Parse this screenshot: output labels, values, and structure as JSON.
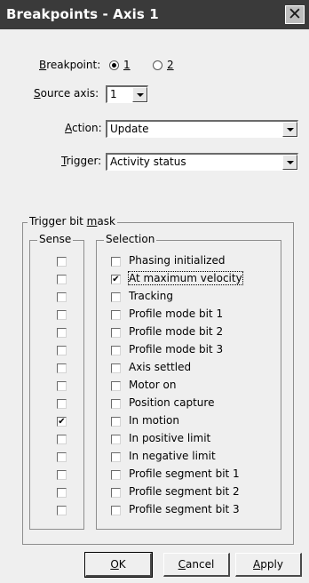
{
  "window": {
    "title": "Breakpoints - Axis 1",
    "close_glyph": "✕"
  },
  "breakpoint": {
    "label_u": "B",
    "label_rest": "reakpoint:",
    "options": [
      {
        "label": "1",
        "selected": true
      },
      {
        "label": "2",
        "selected": false
      }
    ]
  },
  "source_axis": {
    "label_u": "S",
    "label_rest": "ource axis:",
    "value": "1"
  },
  "action": {
    "label_u": "A",
    "label_rest": "ction:",
    "value": "Update"
  },
  "trigger": {
    "label_u": "T",
    "label_rest": "rigger:",
    "value": "Activity status"
  },
  "mask": {
    "legend_pre": "Trigger bit ",
    "legend_u": "m",
    "legend_post": "ask",
    "sense_label": "Sense",
    "selection_label": "Selection",
    "rows": [
      {
        "label": "Phasing initialized",
        "sense": false,
        "selected": false
      },
      {
        "label": "At maximum velocity",
        "sense": false,
        "selected": true
      },
      {
        "label": "Tracking",
        "sense": false,
        "selected": false
      },
      {
        "label": "Profile mode bit 1",
        "sense": false,
        "selected": false
      },
      {
        "label": "Profile mode bit 2",
        "sense": false,
        "selected": false
      },
      {
        "label": "Profile mode bit 3",
        "sense": false,
        "selected": false
      },
      {
        "label": "Axis settled",
        "sense": false,
        "selected": false
      },
      {
        "label": "Motor on",
        "sense": false,
        "selected": false
      },
      {
        "label": "Position capture",
        "sense": false,
        "selected": false
      },
      {
        "label": "In motion",
        "sense": true,
        "selected": false
      },
      {
        "label": "In positive limit",
        "sense": false,
        "selected": false
      },
      {
        "label": "In negative limit",
        "sense": false,
        "selected": false
      },
      {
        "label": "Profile segment bit 1",
        "sense": false,
        "selected": false
      },
      {
        "label": "Profile segment bit 2",
        "sense": false,
        "selected": false
      },
      {
        "label": "Profile segment bit 3",
        "sense": false,
        "selected": false
      }
    ]
  },
  "buttons": {
    "ok_u": "O",
    "ok_rest": "K",
    "cancel_u": "C",
    "cancel_rest": "ancel",
    "apply_u": "A",
    "apply_rest": "pply"
  },
  "check_glyph": "✔"
}
